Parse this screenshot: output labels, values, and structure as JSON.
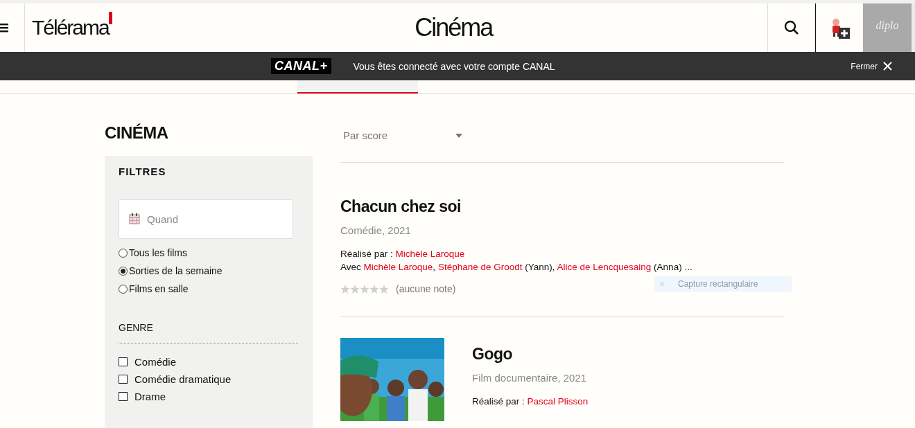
{
  "header": {
    "logo": "Télérama",
    "title": "Cinéma",
    "diplo": "diplo"
  },
  "banner": {
    "brand": "CANAL+",
    "message": "Vous êtes connecté avec votre compte CANAL",
    "close": "Fermer"
  },
  "page_title": "CINÉMA",
  "filters": {
    "title": "FILTRES",
    "date_field": {
      "placeholder": "Quand"
    },
    "periods": [
      {
        "label": "Tous les films",
        "selected": false
      },
      {
        "label": "Sorties de la semaine",
        "selected": true
      },
      {
        "label": "Films en salle",
        "selected": false
      }
    ],
    "genre_title": "GENRE",
    "genres": [
      {
        "label": "Comédie",
        "checked": false
      },
      {
        "label": "Comédie dramatique",
        "checked": false
      },
      {
        "label": "Drame",
        "checked": false
      }
    ]
  },
  "sort": {
    "value": "Par score"
  },
  "films": [
    {
      "title": "Chacun chez soi",
      "meta": "Comédie, 2021",
      "director_label": "Réalisé par :",
      "director": "Michèle Laroque",
      "cast_label": "Avec",
      "cast": [
        {
          "name": "Michèle Laroque",
          "after": ", "
        },
        {
          "name": "Stéphane de Groodt",
          "after": " (Yann), "
        },
        {
          "name": "Alice de Lencquesaing",
          "after": " (Anna) ..."
        }
      ],
      "stars": 0,
      "rating_note": "(aucune note)"
    },
    {
      "title": "Gogo",
      "meta": "Film documentaire, 2021",
      "director_label": "Réalisé par :",
      "director": "Pascal Plisson"
    }
  ],
  "capture_tooltip": "Capture rectangulaire"
}
